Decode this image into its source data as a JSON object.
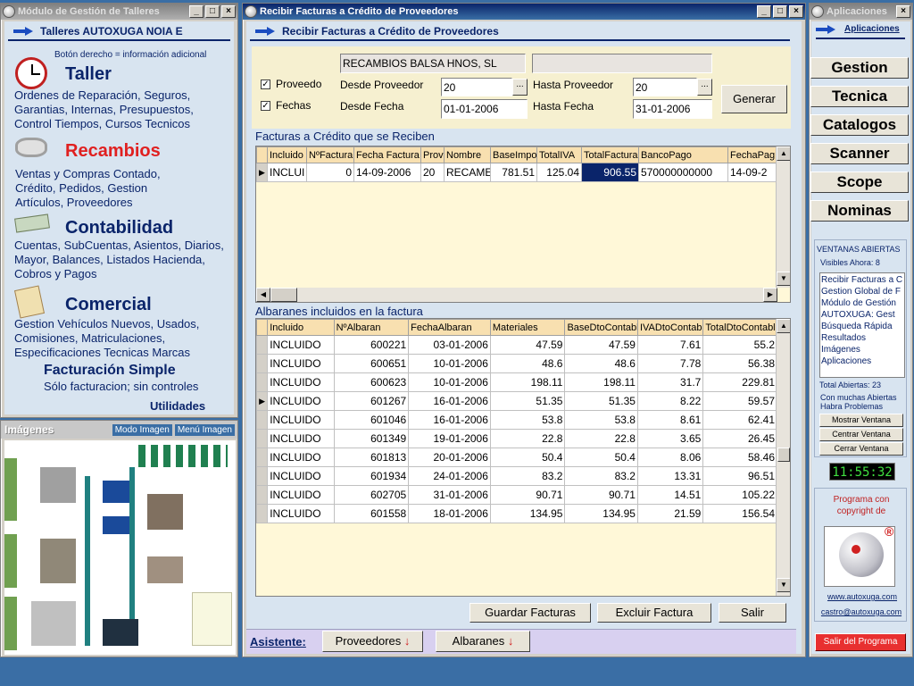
{
  "left_window": {
    "title": "Módulo de Gestión de Talleres",
    "header": "Talleres AUTOXUGA NOIA E",
    "hint": "Botón derecho = información adicional",
    "sections": [
      {
        "title": "Taller",
        "text": "Ordenes de Reparación, Seguros, Garantias, Internas, Presupuestos, Control Tiempos, Cursos Tecnicos"
      },
      {
        "title": "Recambios",
        "text": "Ventas y Compras Contado, Crédito, Pedidos, Gestion Artículos, Proveedores"
      },
      {
        "title": "Contabilidad",
        "text": "Cuentas, SubCuentas, Asientos, Diarios, Mayor, Balances, Listados Hacienda, Cobros y Pagos"
      },
      {
        "title": "Comercial",
        "text": "Gestion Vehículos Nuevos, Usados, Comisiones, Matriculaciones, Especificaciones Tecnicas Marcas"
      }
    ],
    "facturacion_title": "Facturación Simple",
    "facturacion_text": "Sólo facturacion; sin controles",
    "utilidades": "Utilidades"
  },
  "images_panel": {
    "title": "Imágenes",
    "mode_button": "Modo Imagen",
    "menu_button": "Menú Imagen"
  },
  "main_window": {
    "title": "Recibir Facturas a Crédito de Proveedores",
    "header": "Recibir Facturas a Crédito de Proveedores",
    "provider_name": "RECAMBIOS BALSA HNOS, SL",
    "provider_extra": "",
    "check_proveedor": "Proveedo",
    "check_fechas": "Fechas",
    "desde_proveedor_label": "Desde Proveedor",
    "desde_proveedor_value": "20",
    "hasta_proveedor_label": "Hasta Proveedor",
    "hasta_proveedor_value": "20",
    "desde_fecha_label": "Desde Fecha",
    "desde_fecha_value": "01-01-2006",
    "hasta_fecha_label": "Hasta Fecha",
    "hasta_fecha_value": "31-01-2006",
    "generar_button": "Generar",
    "browse_glyph": "...",
    "facturas_title": "Facturas a Crédito que se Reciben",
    "facturas_columns": [
      "Incluido",
      "NºFactura",
      "Fecha Factura",
      "Prov",
      "Nombre",
      "BaseImpo",
      "TotalIVA",
      "TotalFactura",
      "BancoPago",
      "FechaPag"
    ],
    "facturas_rows": [
      [
        "INCLUI",
        "0",
        "14-09-2006",
        "20",
        "RECAME",
        "781.51",
        "125.04",
        "906.55",
        "570000000000",
        "14-09-2"
      ]
    ],
    "albaranes_title": "Albaranes incluidos en la factura",
    "albaranes_columns": [
      "Incluido",
      "NºAlbaran",
      "FechaAlbaran",
      "Materiales",
      "BaseDtoContabl",
      "IVADtoContab",
      "TotalDtoContabl"
    ],
    "albaranes_rows": [
      [
        "INCLUIDO",
        "600221",
        "03-01-2006",
        "47.59",
        "47.59",
        "7.61",
        "55.2"
      ],
      [
        "INCLUIDO",
        "600651",
        "10-01-2006",
        "48.6",
        "48.6",
        "7.78",
        "56.38"
      ],
      [
        "INCLUIDO",
        "600623",
        "10-01-2006",
        "198.11",
        "198.11",
        "31.7",
        "229.81"
      ],
      [
        "INCLUIDO",
        "601267",
        "16-01-2006",
        "51.35",
        "51.35",
        "8.22",
        "59.57"
      ],
      [
        "INCLUIDO",
        "601046",
        "16-01-2006",
        "53.8",
        "53.8",
        "8.61",
        "62.41"
      ],
      [
        "INCLUIDO",
        "601349",
        "19-01-2006",
        "22.8",
        "22.8",
        "3.65",
        "26.45"
      ],
      [
        "INCLUIDO",
        "601813",
        "20-01-2006",
        "50.4",
        "50.4",
        "8.06",
        "58.46"
      ],
      [
        "INCLUIDO",
        "601934",
        "24-01-2006",
        "83.2",
        "83.2",
        "13.31",
        "96.51"
      ],
      [
        "INCLUIDO",
        "602705",
        "31-01-2006",
        "90.71",
        "90.71",
        "14.51",
        "105.22"
      ],
      [
        "INCLUIDO",
        "601558",
        "18-01-2006",
        "134.95",
        "134.95",
        "21.59",
        "156.54"
      ]
    ],
    "guardar_button": "Guardar Facturas",
    "excluir_button": "Excluir Factura",
    "salir_button": "Salir",
    "asistente_label": "Asistente:",
    "proveedores_button": "Proveedores",
    "albaranes_button": "Albaranes"
  },
  "right_window": {
    "title": "Aplicaciones",
    "header": "Aplicaciones",
    "apps": [
      "Gestion",
      "Tecnica",
      "Catalogos",
      "Scanner",
      "Scope",
      "Nominas"
    ],
    "ventanas_title": "VENTANAS ABIERTAS",
    "visibles": "Visibles Ahora: 8",
    "open_windows": [
      "Recibir Facturas a C",
      "Gestion Global de F",
      "Módulo de Gestión",
      "AUTOXUGA: Gest",
      "Búsqueda Rápida",
      "Resultados",
      "Imágenes",
      "Aplicaciones"
    ],
    "total_abiertas": "Total Abiertas: 23",
    "warning": "Con muchas Abiertas Habra Problemas",
    "mostrar_button": "Mostrar Ventana",
    "centrar_button": "Centrar Ventana",
    "cerrar_button": "Cerrar Ventana",
    "clock": "11:55:32",
    "copyright": "Programa con copyright de",
    "registered": "®",
    "website": "www.autoxuga.com",
    "email": "castro@autoxuga.com",
    "exit_button": "Salir del Programa"
  },
  "colors": {
    "accent": "#0a246a",
    "panel": "#f6f0d0",
    "exit": "#e83030",
    "selected": "#0a246a"
  }
}
